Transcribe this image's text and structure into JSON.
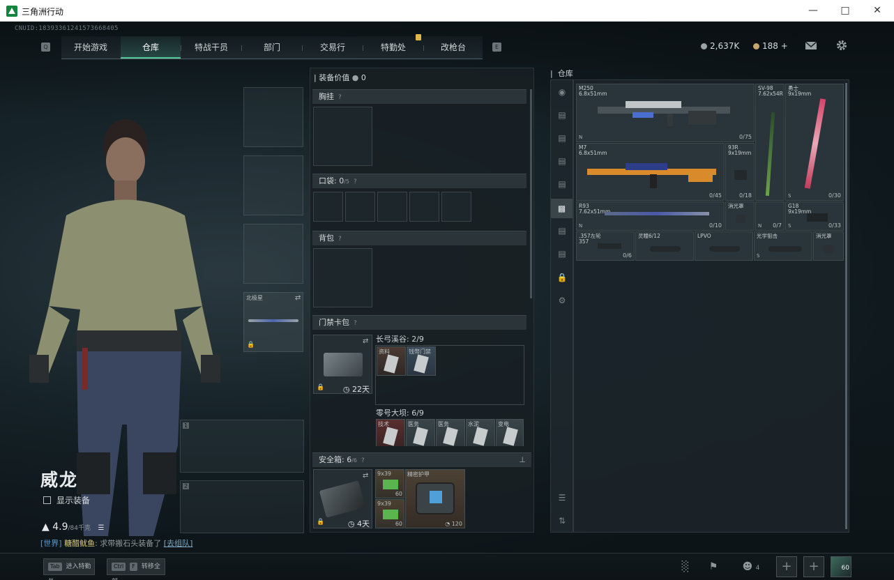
{
  "window": {
    "title": "三角洲行动"
  },
  "uid": "CNUID:18393361241573668405",
  "nav": {
    "left_key": "Q",
    "right_key": "E",
    "tabs": [
      {
        "label": "开始游戏"
      },
      {
        "label": "仓库"
      },
      {
        "label": "特战干员"
      },
      {
        "label": "部门"
      },
      {
        "label": "交易行"
      },
      {
        "label": "特勤处"
      },
      {
        "label": "改枪台"
      }
    ]
  },
  "currency": {
    "hafcoin": "2,637K",
    "delta_coin": "188 +"
  },
  "operator": {
    "name": "威龙",
    "show_gear_label": "显示装备",
    "weight": "4.9",
    "weight_max": "/84千克"
  },
  "chat": {
    "channel": "[世界]",
    "nick": "糖醋鱿鱼",
    "message": "求带搬石头装备了",
    "link": "[去组队]"
  },
  "loadout": {
    "slot_top_label": "北极星",
    "slot1_index": "1",
    "slot2_index": "2"
  },
  "gear_panel": {
    "value_label": "装备价值",
    "value": "0",
    "chest_rig_label": "胸挂",
    "pocket_label": "口袋:",
    "pocket_count": "0",
    "pocket_max": "/5",
    "backpack_label": "背包",
    "keycard_label": "门禁卡包",
    "keycard_days": "22天",
    "map1_label": "长弓溪谷: 2/9",
    "map1_items": [
      "资料",
      "钱幣门禁"
    ],
    "map2_label": "零号大坝: 6/9",
    "map2_items": [
      "技术",
      "医务",
      "医务",
      "水泥",
      "变电"
    ],
    "safebox_label": "安全箱:",
    "safebox_count": "6",
    "safebox_max": "/6",
    "safebox_days": "4天",
    "safebox_items": [
      {
        "name": "9x39",
        "count": "60"
      },
      {
        "name": "9x39",
        "count": "60"
      },
      {
        "name": "精密护甲",
        "count": "120"
      }
    ]
  },
  "warehouse": {
    "title": "仓库",
    "weapons": [
      {
        "name": "M250\n6.8x51mm",
        "count": "0/75",
        "icon": "N"
      },
      {
        "name": "SV-98\n7.62x54R",
        "count": "",
        "icon": ""
      },
      {
        "name": "勇士\n9x19mm",
        "count": "0/30",
        "icon": "S"
      },
      {
        "name": "M7\n6.8x51mm",
        "count": "0/45",
        "icon": ""
      },
      {
        "name": "93R\n9x19mm",
        "count": "0/18",
        "icon": ""
      },
      {
        "name": "R93\n7.62x51mm",
        "count": "0/10",
        "icon": "N"
      },
      {
        "name": "消光罩",
        "count": "",
        "icon": ""
      },
      {
        "name": "",
        "count": "0/7",
        "icon": "N"
      },
      {
        "name": "G18\n9x19mm",
        "count": "0/33",
        "icon": "S"
      },
      {
        "name": ".357左轮\n357",
        "count": "0/6",
        "icon": ""
      },
      {
        "name": "灵瞳6/12",
        "count": "",
        "icon": ""
      },
      {
        "name": "LPVO",
        "count": "",
        "icon": ""
      },
      {
        "name": "光学狙击",
        "count": "",
        "icon": "S"
      },
      {
        "name": "消光罩",
        "count": "",
        "icon": ""
      }
    ]
  },
  "bottom": {
    "tab_key": "Tab",
    "tab_label": "进入特勤处",
    "ctrl_key": "Ctrl",
    "f_key": "F",
    "ctrl_label": "转移全部",
    "squad_count": "4",
    "avatar_level": "60"
  },
  "colors": {
    "accent": "#53c79a",
    "gold": "#e2b74a",
    "panel": "#18252a"
  }
}
